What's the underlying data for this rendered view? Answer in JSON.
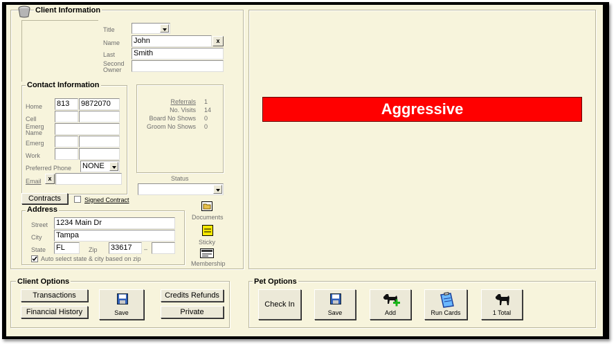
{
  "client_info": {
    "title": "Client Information",
    "labels": {
      "title": "Title",
      "name": "Name",
      "last": "Last",
      "second_owner": "Second\nOwner"
    },
    "values": {
      "title": "",
      "name": "John",
      "last": "Smith",
      "second_owner": ""
    },
    "name_clear": "x"
  },
  "contact": {
    "title": "Contact Information",
    "labels": {
      "home": "Home",
      "cell": "Cell",
      "emerg_name": "Emerg\nName",
      "emerg": "Emerg",
      "work": "Work",
      "preferred_phone": "Preferred Phone",
      "email": "Email"
    },
    "home_area": "813",
    "home_number": "9872070",
    "preferred_phone": "NONE",
    "email_clear": "x"
  },
  "stats": {
    "referrals_label": "Referrals",
    "referrals": "1",
    "no_visits_label": "No. Visits",
    "no_visits": "14",
    "board_no_shows_label": "Board No Shows",
    "board_no_shows": "0",
    "groom_no_shows_label": "Groom No Shows",
    "groom_no_shows": "0",
    "status_label": "Status",
    "status": ""
  },
  "contracts": {
    "button": "Contracts",
    "signed_label": "Signed Contract"
  },
  "address": {
    "title": "Address",
    "labels": {
      "street": "Street",
      "city": "City",
      "state": "State",
      "zip": "Zip",
      "dash": "–"
    },
    "street": "1234 Main Dr",
    "city": "Tampa",
    "state": "FL",
    "zip": "33617",
    "zip_ext": "",
    "auto_select_label": "Auto select state & city based on zip"
  },
  "side_icons": {
    "documents": "Documents",
    "sticky": "Sticky",
    "membership": "Membership"
  },
  "alert": "Aggressive",
  "client_options": {
    "title": "Client Options",
    "transactions": "Transactions",
    "financial_history": "Financial History",
    "save": "Save",
    "credits_refunds": "Credits Refunds",
    "private": "Private"
  },
  "pet_options": {
    "title": "Pet Options",
    "check_in": "Check In",
    "save": "Save",
    "add": "Add",
    "run_cards": "Run Cards",
    "total": "1 Total"
  },
  "colors": {
    "window_bg": "#f7f4dc",
    "alert_bg": "#ff0000",
    "button_bg": "#ece9d8"
  }
}
